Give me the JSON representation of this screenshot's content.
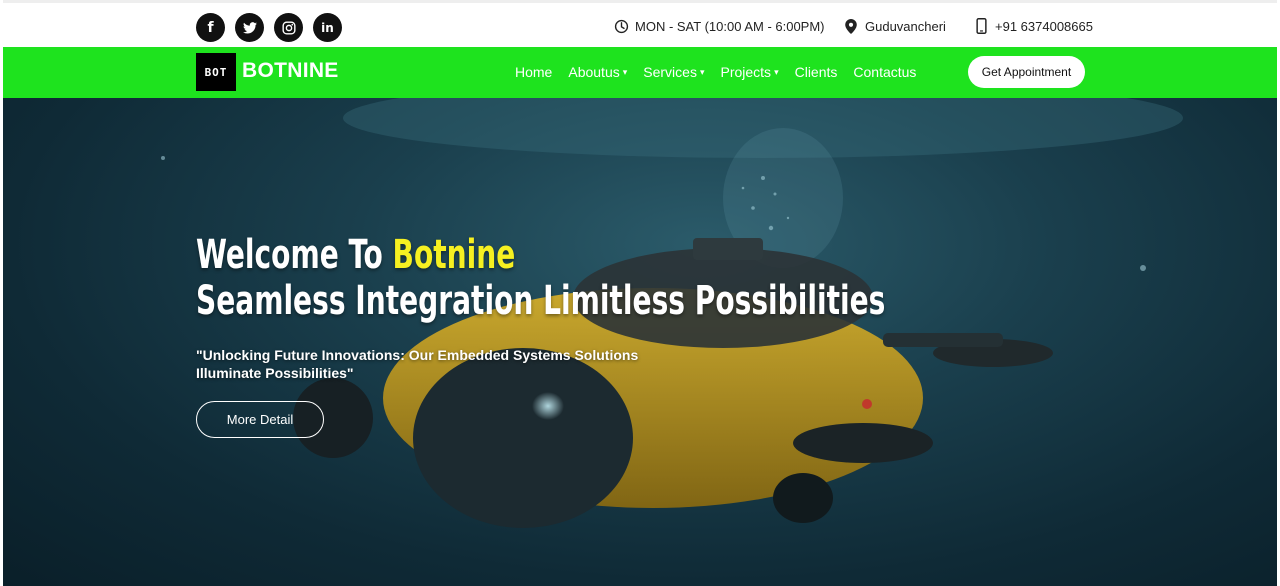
{
  "topbar": {
    "social": [
      {
        "icon": "facebook-icon",
        "glyph": "f"
      },
      {
        "icon": "twitter-icon",
        "glyph": "t"
      },
      {
        "icon": "instagram-icon",
        "glyph": "◎"
      },
      {
        "icon": "linkedin-icon",
        "glyph": "in"
      }
    ],
    "hours": "MON - SAT (10:00 AM - 6:00PM)",
    "location": "Guduvancheri",
    "phone": "+91 6374008665"
  },
  "nav": {
    "logo_mark": "BOT",
    "brand": "BOTNINE",
    "items": [
      {
        "label": "Home",
        "dropdown": false
      },
      {
        "label": "Aboutus",
        "dropdown": true
      },
      {
        "label": "Services",
        "dropdown": true
      },
      {
        "label": "Projects",
        "dropdown": true
      },
      {
        "label": "Clients",
        "dropdown": false
      },
      {
        "label": "Contactus",
        "dropdown": false
      }
    ],
    "cta": "Get Appointment"
  },
  "hero": {
    "title_prefix": "Welcome To ",
    "title_highlight": "Botnine",
    "subtitle": "Seamless Integration Limitless Possibilities",
    "tagline": "\"Unlocking Future Innovations: Our Embedded Systems Solutions Illuminate Possibilities\"",
    "button": "More Detail"
  },
  "colors": {
    "nav_bg": "#1ee31e",
    "highlight": "#f6f021",
    "hero_bg": "#1a3f4d"
  }
}
